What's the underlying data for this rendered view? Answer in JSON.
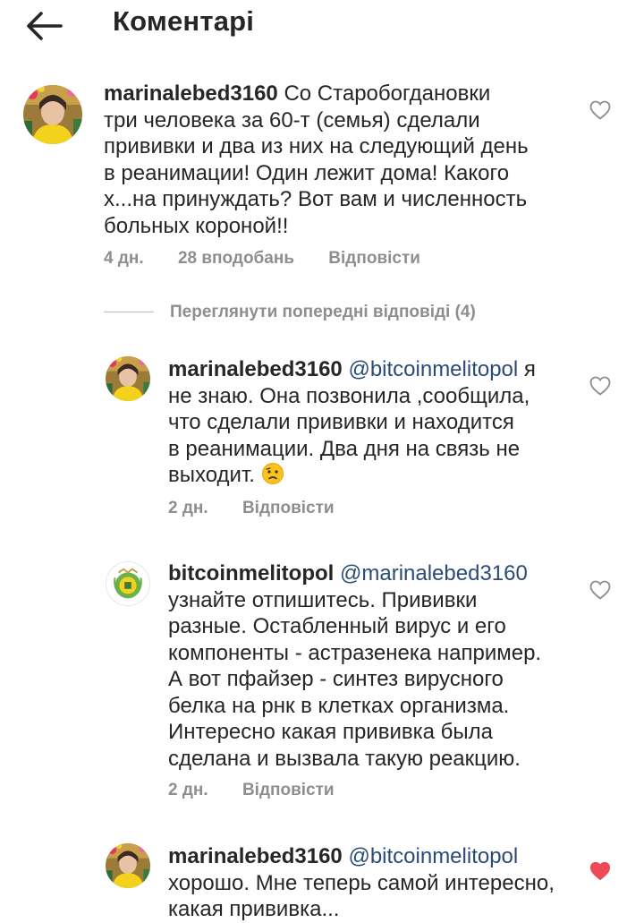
{
  "header": {
    "title": "Коментарі",
    "back_icon": "arrow-left-icon"
  },
  "comments": [
    {
      "username": "marinalebed3160",
      "mention": "",
      "text_lines": [
        "Со Старобогдановки",
        "три человека за 60-т (семья) сделали",
        "прививки и два из них на следующий день",
        "в реанимации! Один лежит дома! Какого",
        "х...на принуждать? Вот вам и численность",
        "больных короной!!"
      ],
      "time": "4 дн.",
      "likes": "28 вподобань",
      "reply": "Відповісти"
    },
    {
      "username": "marinalebed3160",
      "mention": "@bitcoinmelitopol",
      "text_lines": [
        "я",
        "не знаю. Она позвонила ,сообщила,",
        "что сделали прививки и находится",
        "в реанимации. Два дня на связь не",
        "выходит."
      ],
      "time": "2 дн.",
      "reply": "Відповісти"
    },
    {
      "username": "bitcoinmelitopol",
      "mention": "@marinalebed3160",
      "text_lines": [
        "узнайте отпишитесь. Прививки",
        "разные. Остабленный вирус и его",
        "компоненты - астразенека например.",
        "А вот пфайзер - синтез вирусного",
        "белка на рнк в клетках организма.",
        "Интересно какая прививка была",
        "сделана и вызвала такую реакцию."
      ],
      "time": "2 дн.",
      "reply": "Відповісти"
    },
    {
      "username": "marinalebed3160",
      "mention": "@bitcoinmelitopol",
      "text_lines": [
        "хорошо. Мне теперь самой интересно,",
        "какая прививка..."
      ],
      "liked": true
    }
  ],
  "view_previous": "Переглянути попередні відповіді (4)",
  "colors": {
    "mention": "#2a4b78",
    "meta": "#8e8e8e",
    "liked_heart": "#ed4956"
  }
}
